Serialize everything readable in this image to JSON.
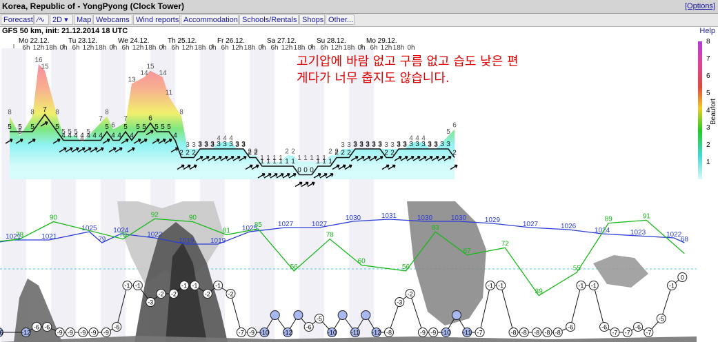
{
  "header": {
    "title": "Korea, Republic of - YongPyong (Clock Tower)",
    "options_label": "[Options]"
  },
  "nav": {
    "items": [
      {
        "key": "forecast",
        "label": "Forecast"
      },
      {
        "key": "meteogram",
        "label": "⁄∿"
      },
      {
        "key": "2d",
        "label": "2D ▾"
      },
      {
        "key": "map",
        "label": "Map"
      },
      {
        "key": "webcams",
        "label": "Webcams"
      },
      {
        "key": "wind",
        "label": "Wind reports"
      },
      {
        "key": "accommodation",
        "label": "Accommodation"
      },
      {
        "key": "schools",
        "label": "Schools/Rentals"
      },
      {
        "key": "shops",
        "label": "Shops"
      },
      {
        "key": "other",
        "label": "Other..."
      }
    ]
  },
  "info": {
    "model": "GFS 50 km, init: 21.12.2014 18 UTC",
    "help_label": "Help"
  },
  "overlay": {
    "line1": "고기압에 바람 없고 구름 없고 습도 낮은 편",
    "line2": "게다가 너무 춥지도 않습니다."
  },
  "colors": {
    "wind_high": "#f2789e",
    "wind_mid": "#7be07a",
    "wind_low": "#8ff0f0",
    "pressure_line": "#2a3cd6",
    "humidity_line": "#18b818",
    "cloud": "#6a6a6a",
    "temp_marker_fill": "#ffffff",
    "precip_marker_fill": "#a8b8f0"
  },
  "chart_data": [
    {
      "type": "area",
      "title": "",
      "days": [
        "Mo 22.12.",
        "Tu 23.12.",
        "We 24.12.",
        "Th 25.12.",
        "Fr 26.12.",
        "Sa 27.12.",
        "Su 28.12.",
        "Mo 29.12."
      ],
      "hour_ticks": [
        "6h",
        "12h",
        "18h",
        "0h"
      ],
      "ylabel": "Beaufort",
      "yticks": [
        1,
        2,
        3,
        4,
        5,
        6,
        7,
        8
      ],
      "ylim": [
        0,
        8
      ],
      "gust_labels": [
        {
          "t": -2,
          "v": "8"
        },
        {
          "t": 3,
          "v": "5"
        },
        {
          "t": 9,
          "v": "8"
        },
        {
          "t": 12,
          "v": "16"
        },
        {
          "t": 15,
          "v": "15"
        },
        {
          "t": 21,
          "v": "8"
        },
        {
          "t": 24,
          "v": "5"
        },
        {
          "t": 27,
          "v": "5"
        },
        {
          "t": 30,
          "v": "5"
        },
        {
          "t": 33,
          "v": "4"
        },
        {
          "t": 36,
          "v": "5"
        },
        {
          "t": 42,
          "v": "7"
        },
        {
          "t": 45,
          "v": "8"
        },
        {
          "t": 48,
          "v": "6"
        },
        {
          "t": 54,
          "v": "7"
        },
        {
          "t": 57,
          "v": "13"
        },
        {
          "t": 63,
          "v": "14"
        },
        {
          "t": 66,
          "v": "15"
        },
        {
          "t": 72,
          "v": "14"
        },
        {
          "t": 75,
          "v": "11"
        },
        {
          "t": 81,
          "v": "8"
        },
        {
          "t": 84,
          "v": "3"
        },
        {
          "t": 87,
          "v": "3"
        },
        {
          "t": 90,
          "v": "3"
        },
        {
          "t": 93,
          "v": "3"
        },
        {
          "t": 96,
          "v": "3"
        },
        {
          "t": 99,
          "v": "4"
        },
        {
          "t": 102,
          "v": "4"
        },
        {
          "t": 105,
          "v": "4"
        },
        {
          "t": 108,
          "v": "3"
        },
        {
          "t": 111,
          "v": "3"
        },
        {
          "t": 114,
          "v": "2"
        },
        {
          "t": 117,
          "v": "2"
        },
        {
          "t": 120,
          "v": "1"
        },
        {
          "t": 123,
          "v": "1"
        },
        {
          "t": 126,
          "v": "1"
        },
        {
          "t": 129,
          "v": "1"
        },
        {
          "t": 132,
          "v": "2"
        },
        {
          "t": 135,
          "v": "2"
        },
        {
          "t": 138,
          "v": "1"
        },
        {
          "t": 141,
          "v": "1"
        },
        {
          "t": 144,
          "v": "1"
        },
        {
          "t": 147,
          "v": "1"
        },
        {
          "t": 150,
          "v": "1"
        },
        {
          "t": 153,
          "v": "2"
        },
        {
          "t": 156,
          "v": "2"
        },
        {
          "t": 159,
          "v": "3"
        },
        {
          "t": 162,
          "v": "3"
        },
        {
          "t": 165,
          "v": "3"
        },
        {
          "t": 168,
          "v": "3"
        },
        {
          "t": 171,
          "v": "3"
        },
        {
          "t": 174,
          "v": "3"
        },
        {
          "t": 177,
          "v": "3"
        },
        {
          "t": 180,
          "v": "3"
        },
        {
          "t": 183,
          "v": "3"
        },
        {
          "t": 186,
          "v": "3"
        },
        {
          "t": 189,
          "v": "3"
        },
        {
          "t": 192,
          "v": "4"
        },
        {
          "t": 195,
          "v": "4"
        },
        {
          "t": 198,
          "v": "4"
        },
        {
          "t": 201,
          "v": "3"
        },
        {
          "t": 204,
          "v": "3"
        },
        {
          "t": 210,
          "v": "5"
        },
        {
          "t": 213,
          "v": "6"
        }
      ],
      "wind_labels": [
        {
          "t": -2,
          "v": "5"
        },
        {
          "t": 3,
          "v": "5"
        },
        {
          "t": 9,
          "v": "5"
        },
        {
          "t": 15,
          "v": "7"
        },
        {
          "t": 21,
          "v": "5"
        },
        {
          "t": 24,
          "v": "4"
        },
        {
          "t": 27,
          "v": "4"
        },
        {
          "t": 30,
          "v": "4"
        },
        {
          "t": 33,
          "v": "4"
        },
        {
          "t": 36,
          "v": "4"
        },
        {
          "t": 39,
          "v": "4"
        },
        {
          "t": 42,
          "v": "4"
        },
        {
          "t": 45,
          "v": "5"
        },
        {
          "t": 48,
          "v": "4"
        },
        {
          "t": 51,
          "v": "4"
        },
        {
          "t": 54,
          "v": "5"
        },
        {
          "t": 57,
          "v": "4"
        },
        {
          "t": 60,
          "v": "5"
        },
        {
          "t": 63,
          "v": "5"
        },
        {
          "t": 66,
          "v": "6"
        },
        {
          "t": 69,
          "v": "5"
        },
        {
          "t": 72,
          "v": "5"
        },
        {
          "t": 75,
          "v": "5"
        },
        {
          "t": 78,
          "v": "4"
        },
        {
          "t": 81,
          "v": "2"
        },
        {
          "t": 84,
          "v": "2"
        },
        {
          "t": 87,
          "v": "2"
        },
        {
          "t": 90,
          "v": "3"
        },
        {
          "t": 93,
          "v": "3"
        },
        {
          "t": 96,
          "v": "3"
        },
        {
          "t": 99,
          "v": "3"
        },
        {
          "t": 102,
          "v": "3"
        },
        {
          "t": 105,
          "v": "3"
        },
        {
          "t": 108,
          "v": "3"
        },
        {
          "t": 111,
          "v": "3"
        },
        {
          "t": 114,
          "v": "2"
        },
        {
          "t": 117,
          "v": "2"
        },
        {
          "t": 120,
          "v": "1"
        },
        {
          "t": 123,
          "v": "1"
        },
        {
          "t": 126,
          "v": "1"
        },
        {
          "t": 129,
          "v": "1"
        },
        {
          "t": 132,
          "v": "1"
        },
        {
          "t": 135,
          "v": "1"
        },
        {
          "t": 138,
          "v": "0"
        },
        {
          "t": 141,
          "v": "0"
        },
        {
          "t": 144,
          "v": "0"
        },
        {
          "t": 147,
          "v": "1"
        },
        {
          "t": 150,
          "v": "1"
        },
        {
          "t": 153,
          "v": "1"
        },
        {
          "t": 156,
          "v": "2"
        },
        {
          "t": 159,
          "v": "2"
        },
        {
          "t": 162,
          "v": "2"
        },
        {
          "t": 165,
          "v": "3"
        },
        {
          "t": 168,
          "v": "3"
        },
        {
          "t": 171,
          "v": "3"
        },
        {
          "t": 174,
          "v": "3"
        },
        {
          "t": 177,
          "v": "3"
        },
        {
          "t": 180,
          "v": "2"
        },
        {
          "t": 183,
          "v": "2"
        },
        {
          "t": 186,
          "v": "3"
        },
        {
          "t": 189,
          "v": "3"
        },
        {
          "t": 192,
          "v": "3"
        },
        {
          "t": 195,
          "v": "3"
        },
        {
          "t": 198,
          "v": "3"
        },
        {
          "t": 201,
          "v": "3"
        },
        {
          "t": 204,
          "v": "3"
        },
        {
          "t": 207,
          "v": "3"
        },
        {
          "t": 210,
          "v": "3"
        },
        {
          "t": 213,
          "v": "2"
        }
      ]
    },
    {
      "type": "line",
      "title": "",
      "pressure_labels": [
        {
          "t": -4,
          "v": "4"
        },
        {
          "t": 5,
          "v": "1021"
        },
        {
          "t": 22,
          "v": "1021"
        },
        {
          "t": 41,
          "v": "1025"
        },
        {
          "t": 47,
          "v": "79"
        },
        {
          "t": 56,
          "v": "1024"
        },
        {
          "t": 72,
          "v": "1022"
        },
        {
          "t": 87,
          "v": "1019"
        },
        {
          "t": 102,
          "v": "1019"
        },
        {
          "t": 117,
          "v": "1025"
        },
        {
          "t": 134,
          "v": "1027"
        },
        {
          "t": 150,
          "v": "1027"
        },
        {
          "t": 166,
          "v": "1030"
        },
        {
          "t": 183,
          "v": "1031"
        },
        {
          "t": 200,
          "v": "1030"
        },
        {
          "t": 216,
          "v": "1030"
        },
        {
          "t": 232,
          "v": "1029"
        },
        {
          "t": 250,
          "v": "1027"
        },
        {
          "t": 268,
          "v": "1026"
        },
        {
          "t": 284,
          "v": "1024"
        },
        {
          "t": 301,
          "v": "1023"
        },
        {
          "t": 318,
          "v": "1022"
        },
        {
          "t": 323,
          "v": "68"
        }
      ],
      "humidity_labels": [
        {
          "t": 8,
          "v": "78"
        },
        {
          "t": 24,
          "v": "90"
        },
        {
          "t": 57,
          "v": "78"
        },
        {
          "t": 72,
          "v": "92"
        },
        {
          "t": 90,
          "v": "90"
        },
        {
          "t": 106,
          "v": "81"
        },
        {
          "t": 121,
          "v": "85"
        },
        {
          "t": 138,
          "v": "56"
        },
        {
          "t": 155,
          "v": "78"
        },
        {
          "t": 170,
          "v": "60"
        },
        {
          "t": 191,
          "v": "56"
        },
        {
          "t": 205,
          "v": "83"
        },
        {
          "t": 220,
          "v": "67"
        },
        {
          "t": 238,
          "v": "72"
        },
        {
          "t": 254,
          "v": "39"
        },
        {
          "t": 272,
          "v": "55"
        },
        {
          "t": 287,
          "v": "89"
        },
        {
          "t": 305,
          "v": "91"
        }
      ],
      "temperature_labels": [
        {
          "t": -2,
          "v": "-16"
        },
        {
          "t": 11,
          "v": "-12"
        },
        {
          "t": 16,
          "v": "-6"
        },
        {
          "t": 21,
          "v": "-6"
        },
        {
          "t": 27,
          "v": "-9"
        },
        {
          "t": 32,
          "v": "-9"
        },
        {
          "t": 38,
          "v": "-9"
        },
        {
          "t": 43,
          "v": "-9"
        },
        {
          "t": 49,
          "v": "-9"
        },
        {
          "t": 54,
          "v": "-6"
        },
        {
          "t": 59,
          "v": "-1"
        },
        {
          "t": 64,
          "v": "-1"
        },
        {
          "t": 70,
          "v": "-3"
        },
        {
          "t": 75,
          "v": "-2"
        },
        {
          "t": 81,
          "v": "-2"
        },
        {
          "t": 86,
          "v": "-1"
        },
        {
          "t": 91,
          "v": "-1"
        },
        {
          "t": 97,
          "v": "-2"
        },
        {
          "t": 102,
          "v": "-1"
        },
        {
          "t": 108,
          "v": "-2"
        },
        {
          "t": 113,
          "v": "-7"
        },
        {
          "t": 118,
          "v": "-9"
        },
        {
          "t": 124,
          "v": "-10"
        },
        {
          "t": 129,
          "v": ""
        },
        {
          "t": 135,
          "v": "-12"
        },
        {
          "t": 140,
          "v": ""
        },
        {
          "t": 145,
          "v": "-6"
        },
        {
          "t": 150,
          "v": "-5"
        },
        {
          "t": 156,
          "v": "-10"
        },
        {
          "t": 161,
          "v": ""
        },
        {
          "t": 167,
          "v": "-11"
        },
        {
          "t": 172,
          "v": ""
        },
        {
          "t": 177,
          "v": "-12"
        },
        {
          "t": 183,
          "v": "-8"
        },
        {
          "t": 188,
          "v": "-3"
        },
        {
          "t": 193,
          "v": "-2"
        },
        {
          "t": 199,
          "v": "-9"
        },
        {
          "t": 204,
          "v": "-9"
        },
        {
          "t": 210,
          "v": "-10"
        },
        {
          "t": 215,
          "v": ""
        },
        {
          "t": 220,
          "v": "-11"
        },
        {
          "t": 226,
          "v": "-7"
        },
        {
          "t": 231,
          "v": "-1"
        },
        {
          "t": 236,
          "v": "-1"
        },
        {
          "t": 242,
          "v": "-8"
        },
        {
          "t": 247,
          "v": "-8"
        },
        {
          "t": 253,
          "v": "-8"
        },
        {
          "t": 258,
          "v": "-8"
        },
        {
          "t": 263,
          "v": "-8"
        },
        {
          "t": 269,
          "v": "-6"
        },
        {
          "t": 274,
          "v": "-1"
        },
        {
          "t": 280,
          "v": "-1"
        },
        {
          "t": 285,
          "v": "-6"
        },
        {
          "t": 290,
          "v": "-7"
        },
        {
          "t": 296,
          "v": "-7"
        },
        {
          "t": 301,
          "v": "-6"
        },
        {
          "t": 306,
          "v": "-7"
        },
        {
          "t": 312,
          "v": "-5"
        },
        {
          "t": 317,
          "v": "-1"
        },
        {
          "t": 322,
          "v": "0"
        }
      ]
    }
  ]
}
